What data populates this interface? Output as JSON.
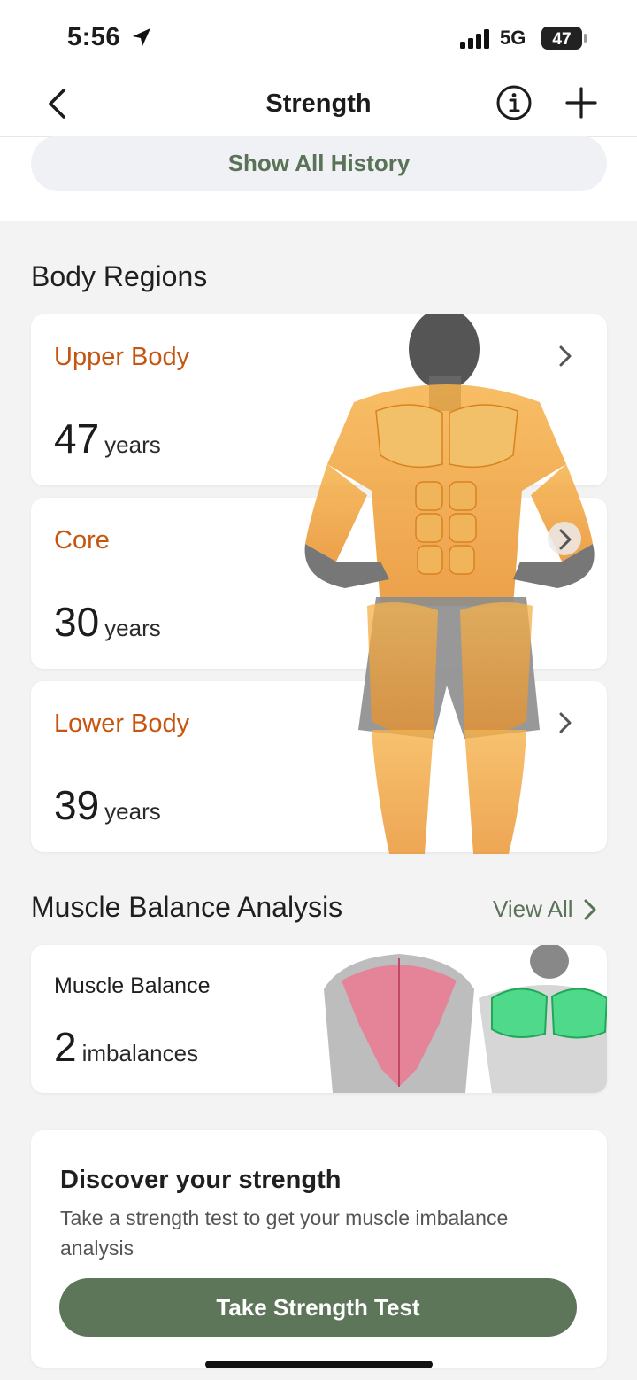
{
  "status_bar": {
    "time": "5:56",
    "network": "5G",
    "battery": "47"
  },
  "nav": {
    "title": "Strength",
    "icons": [
      "chevron-left-icon",
      "info-icon",
      "plus-icon"
    ]
  },
  "history": {
    "button_label": "Show All History"
  },
  "body_regions": {
    "title": "Body Regions",
    "items": [
      {
        "label": "Upper Body",
        "value": "47",
        "unit": "years"
      },
      {
        "label": "Core",
        "value": "30",
        "unit": "years"
      },
      {
        "label": "Lower Body",
        "value": "39",
        "unit": "years"
      }
    ]
  },
  "muscle_balance": {
    "title": "Muscle Balance Analysis",
    "view_all": "View All",
    "card_label": "Muscle Balance",
    "value": "2",
    "unit": "imbalances"
  },
  "discover": {
    "title": "Discover your strength",
    "description": "Take a strength test to get your muscle imbalance analysis",
    "button_label": "Take Strength Test"
  },
  "colors": {
    "accent_green": "#5d7559",
    "region_orange": "#c65510",
    "muscle_highlight": "#f0a020"
  }
}
